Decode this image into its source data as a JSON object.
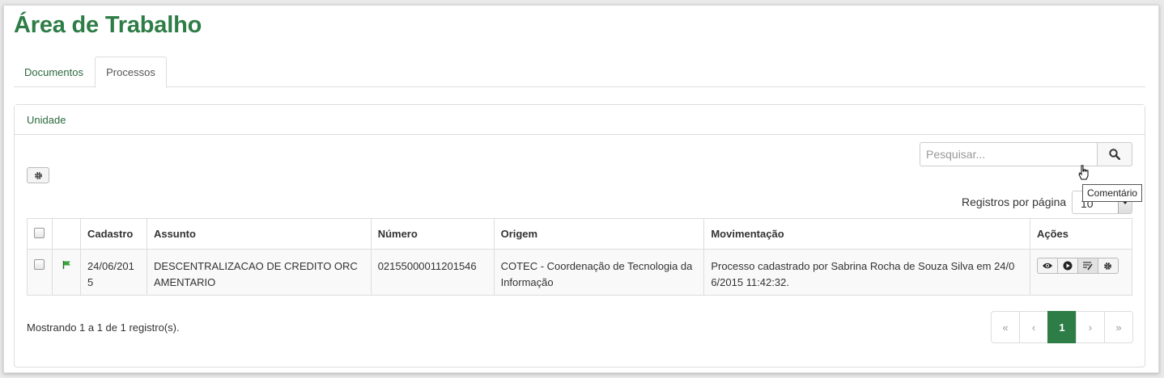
{
  "page": {
    "title": "Área de Trabalho"
  },
  "tabs": [
    {
      "label": "Documentos",
      "active": false
    },
    {
      "label": "Processos",
      "active": true
    }
  ],
  "panel": {
    "heading": "Unidade"
  },
  "search": {
    "placeholder": "Pesquisar...",
    "icon": "search-icon"
  },
  "records_per_page": {
    "label": "Registros por página",
    "value": "10"
  },
  "table": {
    "columns": [
      "",
      "",
      "Cadastro",
      "Assunto",
      "Número",
      "Origem",
      "Movimentação",
      "Ações"
    ],
    "rows": [
      {
        "checked": false,
        "flag_color": "#3aa33a",
        "cadastro": "24/06/2015",
        "assunto": "DESCENTRALIZACAO DE CREDITO ORCAMENTARIO",
        "numero": "02155000011201546",
        "origem": "COTEC - Coordenação de Tecnologia da Informação",
        "movimentacao": "Processo cadastrado por Sabrina Rocha de Souza Silva em 24/06/2015 11:42:32.",
        "actions": [
          "eye-icon",
          "play-icon",
          "comment-icon",
          "gear-icon"
        ]
      }
    ]
  },
  "tooltip": {
    "text": "Comentário"
  },
  "footer": {
    "showing": "Mostrando 1 a 1 de 1 registro(s)."
  },
  "pagination": {
    "first": "«",
    "prev": "‹",
    "current": "1",
    "next": "›",
    "last": "»"
  },
  "colors": {
    "brand": "#2e7d46",
    "link": "#2b6a3d"
  }
}
